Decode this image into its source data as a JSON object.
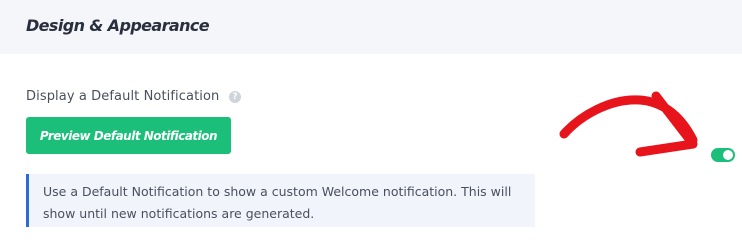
{
  "section": {
    "title": "Design & Appearance"
  },
  "setting": {
    "label": "Display a Default Notification",
    "help_icon": "?",
    "toggle_on": true,
    "toggle_color": "#1cbf79"
  },
  "preview_button": {
    "label": "Preview Default Notification",
    "color": "#1cbf79"
  },
  "info": {
    "text": "Use a Default Notification to show a custom Welcome notification. This will show until new notifications are generated.",
    "accent_color": "#2b6bd6"
  },
  "annotation": {
    "icon": "red-hand-drawn-arrow-icon",
    "color": "#e8141c"
  }
}
